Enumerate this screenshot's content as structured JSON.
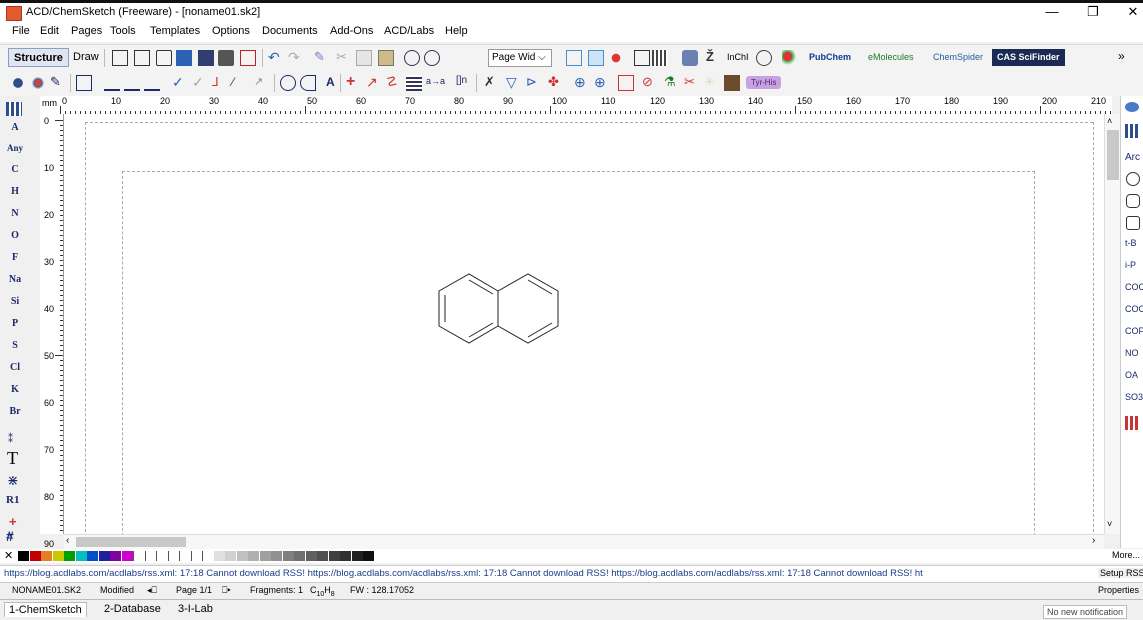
{
  "window": {
    "title": "ACD/ChemSketch (Freeware) - [noname01.sk2]",
    "minimize_glyph": "—",
    "restore_glyph": "❐",
    "close_glyph": "✕"
  },
  "menu": [
    "File",
    "Edit",
    "Pages",
    "Tools",
    "Templates",
    "Options",
    "Documents",
    "Add-Ons",
    "ACD/Labs",
    "Help"
  ],
  "toolbar": {
    "structure_tab": "Structure",
    "draw_tab": "Draw",
    "zoom_select": "Page Wid",
    "inchi_label": "InChI",
    "pubchem_label": "PubChem",
    "emolecules_label": "eMolecules",
    "chemspider_label": "ChemSpider",
    "scifinder_label": "CAS SciFinder",
    "overflow": "»",
    "sequence_label": "Tyr-His",
    "text_a_label": "A",
    "bracket_label": "[]n",
    "arrow_label": "a→a"
  },
  "left_palette": {
    "items": [
      "A",
      "Any",
      "C",
      "H",
      "N",
      "O",
      "F",
      "Na",
      "Si",
      "P",
      "S",
      "Cl",
      "K",
      "Br"
    ],
    "text_tool": "T",
    "r_group": "R1",
    "plus": "+",
    "hash": "#"
  },
  "ruler": {
    "unit": "mm",
    "h_ticks": [
      "0",
      "10",
      "20",
      "30",
      "40",
      "50",
      "60",
      "70",
      "80",
      "90",
      "100",
      "110",
      "120",
      "130",
      "140",
      "150",
      "160",
      "170",
      "180",
      "190",
      "200",
      "210"
    ],
    "v_ticks": [
      "0",
      "10",
      "20",
      "30",
      "40",
      "50",
      "60",
      "70",
      "80",
      "90"
    ]
  },
  "right_palette": {
    "items": [
      "Arc",
      "t-B",
      "i-P",
      "COC",
      "COO",
      "COF",
      "NO",
      "OA",
      "SO3"
    ]
  },
  "color_strip": {
    "colors": [
      "#000000",
      "#c00000",
      "#e67e22",
      "#c9c900",
      "#00a000",
      "#00c0c0",
      "#0050c8",
      "#1f1fa0",
      "#8000a0",
      "#d000d0",
      "#ffffff",
      "#ffffff",
      "#ffffff",
      "#ffffff",
      "#ffffff",
      "#ffffff",
      "#ffffff",
      "#e0e0e0",
      "#d0d0d0",
      "#c0c0c0",
      "#b0b0b0",
      "#a0a0a0",
      "#909090",
      "#808080",
      "#707070",
      "#606060",
      "#505050",
      "#404040",
      "#303030",
      "#202020",
      "#101010"
    ],
    "more": "More..."
  },
  "rss_text": "https://blog.acdlabs.com/acdlabs/rss.xml: 17:18 Cannot download RSS! https://blog.acdlabs.com/acdlabs/rss.xml: 17:18 Cannot download RSS! https://blog.acdlabs.com/acdlabs/rss.xml: 17:18 Cannot download RSS! ht",
  "rss_setup": "Setup RSS",
  "status": {
    "file": "NONAME01.SK2",
    "state": "Modified",
    "page": "Page 1/1",
    "fragments": "Fragments: 1",
    "formula_c": "C",
    "formula_c_sub": "10",
    "formula_h": "H",
    "formula_h_sub": "8",
    "fw": "FW : 128.17052",
    "properties": "Properties"
  },
  "bottom_tabs": [
    "1-ChemSketch",
    "2-Database",
    "3-I-Lab"
  ],
  "notification": "No new notification"
}
